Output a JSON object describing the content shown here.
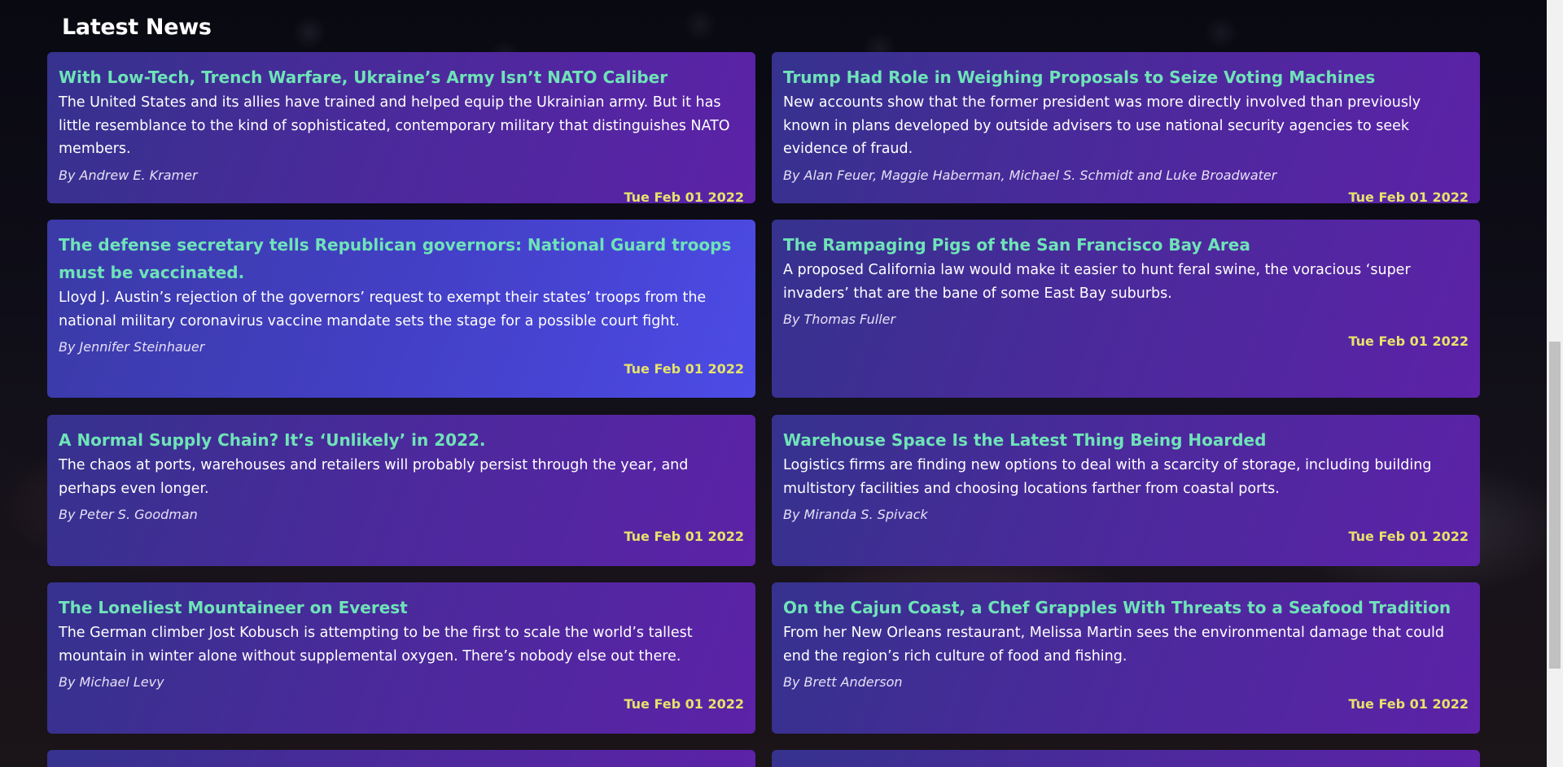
{
  "section": {
    "title": "Latest News"
  },
  "colors": {
    "card_title": "#6fe3b8",
    "card_date": "#e6e36a",
    "card_gradient_start": "#35328e",
    "card_gradient_end": "#5c22a8",
    "card_hover": "#4c4be6"
  },
  "articles": [
    {
      "title": "With Low-Tech, Trench Warfare, Ukraine’s Army Isn’t NATO Caliber",
      "description": "The United States and its allies have trained and helped equip the Ukrainian army. But it has little resemblance to the kind of sophisticated, contemporary military that distinguishes NATO members.",
      "author": "By Andrew E. Kramer",
      "date": "Tue Feb 01 2022"
    },
    {
      "title": "Trump Had Role in Weighing Proposals to Seize Voting Machines",
      "description": "New accounts show that the former president was more directly involved than previously known in plans developed by outside advisers to use national security agencies to seek evidence of fraud.",
      "author": "By Alan Feuer, Maggie Haberman, Michael S. Schmidt and Luke Broadwater",
      "date": "Tue Feb 01 2022"
    },
    {
      "title": "The defense secretary tells Republican governors: National Guard troops must be vaccinated.",
      "description": "Lloyd J. Austin’s rejection of the governors’ request to exempt their states’ troops from the national military coronavirus vaccine mandate sets the stage for a possible court fight.",
      "author": "By Jennifer Steinhauer",
      "date": "Tue Feb 01 2022"
    },
    {
      "title": "The Rampaging Pigs of the San Francisco Bay Area",
      "description": "A proposed California law would make it easier to hunt feral swine, the voracious ‘super invaders’ that are the bane of some East Bay suburbs.",
      "author": "By Thomas Fuller",
      "date": "Tue Feb 01 2022"
    },
    {
      "title": "A Normal Supply Chain? It’s ‘Unlikely’ in 2022.",
      "description": "The chaos at ports, warehouses and retailers will probably persist through the year, and perhaps even longer.",
      "author": "By Peter S. Goodman",
      "date": "Tue Feb 01 2022"
    },
    {
      "title": "Warehouse Space Is the Latest Thing Being Hoarded",
      "description": "Logistics firms are finding new options to deal with a scarcity of storage, including building multistory facilities and choosing locations farther from coastal ports.",
      "author": "By Miranda S. Spivack",
      "date": "Tue Feb 01 2022"
    },
    {
      "title": "The Loneliest Mountaineer on Everest",
      "description": "The German climber Jost Kobusch is attempting to be the first to scale the world’s tallest mountain in winter alone without supplemental oxygen. There’s nobody else out there.",
      "author": "By Michael Levy",
      "date": "Tue Feb 01 2022"
    },
    {
      "title": "On the Cajun Coast, a Chef Grapples With Threats to a Seafood Tradition",
      "description": "From her New Orleans restaurant, Melissa Martin sees the environmental damage that could end the region’s rich culture of food and fishing.",
      "author": "By Brett Anderson",
      "date": "Tue Feb 01 2022"
    }
  ]
}
